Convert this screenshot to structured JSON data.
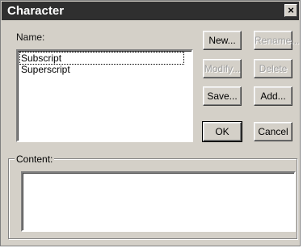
{
  "window": {
    "title": "Character",
    "close_glyph": "×"
  },
  "name_label": "Name:",
  "list": {
    "items": [
      "Subscript",
      "Superscript"
    ],
    "selected_index": 0
  },
  "buttons": {
    "new": "New...",
    "rename": "Rename...",
    "modify": "Modify...",
    "delete": "Delete",
    "save": "Save...",
    "add": "Add...",
    "ok": "OK",
    "cancel": "Cancel"
  },
  "content_label": "Content:",
  "content_value": ""
}
